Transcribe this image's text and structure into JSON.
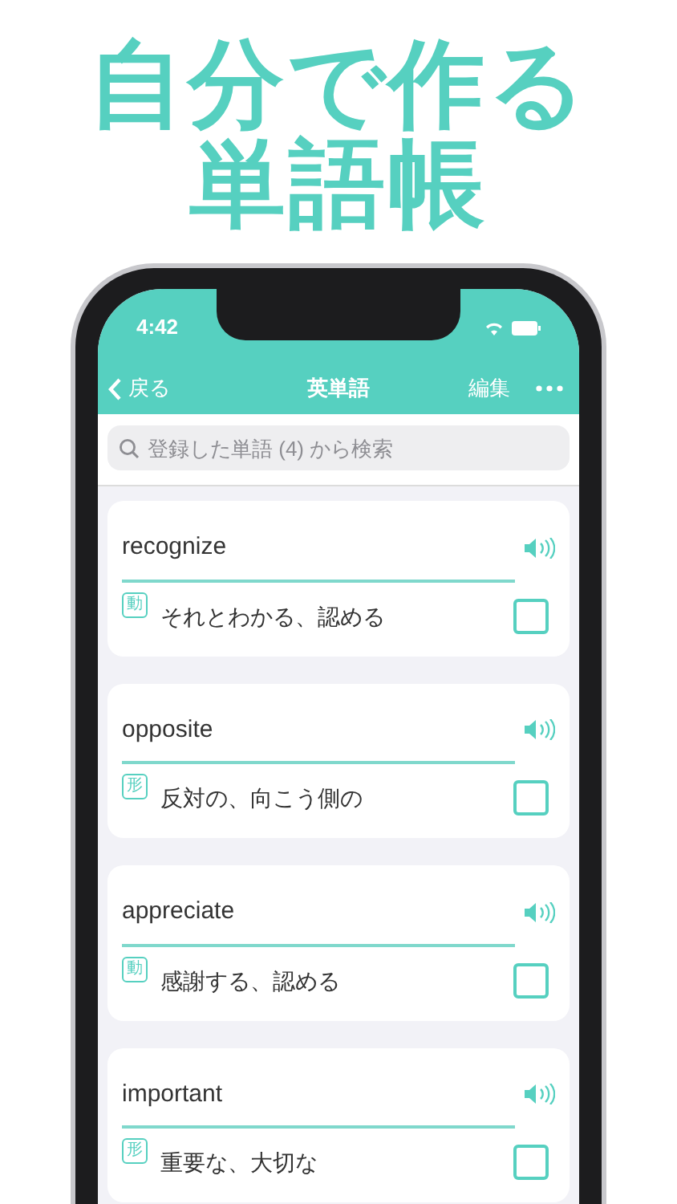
{
  "headline": [
    "自分で作る",
    "単語帳"
  ],
  "status_bar": {
    "time": "4:42"
  },
  "nav": {
    "back": "戻る",
    "title": "英単語",
    "edit": "編集"
  },
  "search": {
    "placeholder": "登録した単語 (4) から検索"
  },
  "words": [
    {
      "word": "recognize",
      "pos": "動",
      "meaning": "それとわかる、認める",
      "checked": false
    },
    {
      "word": "opposite",
      "pos": "形",
      "meaning": "反対の、向こう側の",
      "checked": false
    },
    {
      "word": "appreciate",
      "pos": "動",
      "meaning": "感謝する、認める",
      "checked": false
    },
    {
      "word": "important",
      "pos": "形",
      "meaning": "重要な、大切な",
      "checked": false
    }
  ]
}
